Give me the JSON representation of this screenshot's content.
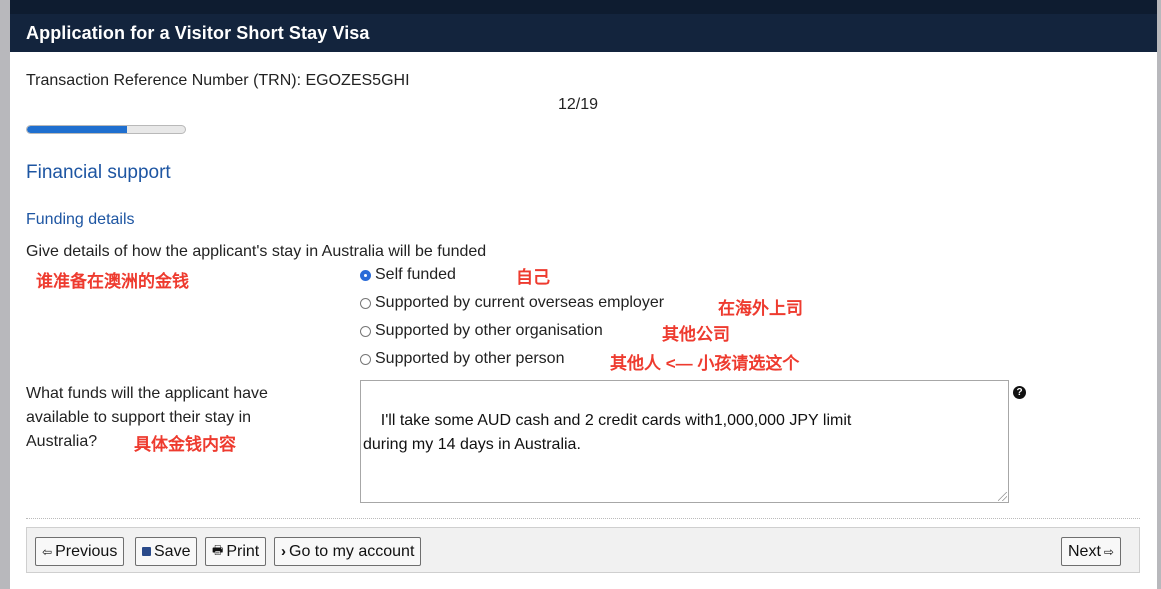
{
  "header": {
    "title": "Application for a Visitor Short Stay Visa"
  },
  "trn": "Transaction Reference Number (TRN): EGOZES5GHI",
  "step": "12/19",
  "progress": {
    "value": 0.63
  },
  "section_title": "Financial support",
  "subsection_title": "Funding details",
  "funding_question": {
    "label": "Give details of how the applicant's stay in Australia will be funded",
    "options": [
      {
        "label": "Self funded",
        "checked": true
      },
      {
        "label": "Supported by current overseas employer",
        "checked": false
      },
      {
        "label": "Supported by other organisation",
        "checked": false
      },
      {
        "label": "Supported by other person",
        "checked": false
      }
    ]
  },
  "funds_question": {
    "label": "What funds will the applicant have available to support their stay in Australia?",
    "value": "I'll take some AUD cash and 2 credit cards with1,000,000 JPY limit\nduring my 14 days in Australia."
  },
  "annotations": {
    "funding_question": "谁准备在澳洲的金钱",
    "self_funded": "自己",
    "employer": "在海外上司",
    "organisation": "其他公司",
    "other_person": "其他人 <— 小孩请选这个",
    "funds": "具体金钱内容"
  },
  "footer": {
    "previous": "Previous",
    "save": "Save",
    "print": "Print",
    "account": "Go to my account",
    "next": "Next"
  },
  "icons": {
    "previous": "arrow-left-icon",
    "save": "floppy-disk-icon",
    "print": "printer-icon",
    "account": "chevron-right-icon",
    "next": "arrow-right-icon",
    "help": "question-circle-icon"
  },
  "colors": {
    "header_bg": "#13243d",
    "link_blue": "#1d55a2",
    "annotation_red": "#ee3b2f",
    "progress_blue": "#1f6fcf"
  }
}
